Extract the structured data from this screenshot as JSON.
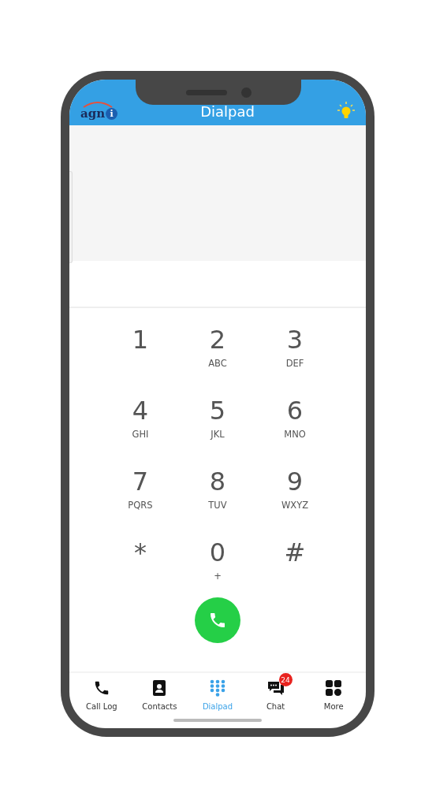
{
  "header": {
    "logo_text": "agn",
    "logo_mark": "i",
    "title": "Dialpad"
  },
  "keypad": [
    {
      "digit": "1"
    },
    {
      "digit": "2",
      "letters": "ABC"
    },
    {
      "digit": "3",
      "letters": "DEF"
    },
    {
      "digit": "4",
      "letters": "GHI"
    },
    {
      "digit": "5",
      "letters": "JKL"
    },
    {
      "digit": "6",
      "letters": "MNO"
    },
    {
      "digit": "7",
      "letters": "PQRS"
    },
    {
      "digit": "8",
      "letters": "TUV"
    },
    {
      "digit": "9",
      "letters": "WXYZ"
    },
    {
      "digit": "*"
    },
    {
      "digit": "0",
      "letters": "+"
    },
    {
      "digit": "#"
    }
  ],
  "tabs": [
    {
      "kind": "phone",
      "label": "Call Log",
      "selected": false
    },
    {
      "kind": "contacts",
      "label": "Contacts",
      "selected": false
    },
    {
      "kind": "dialpad",
      "label": "Dialpad",
      "selected": true
    },
    {
      "kind": "chat",
      "label": "Chat",
      "selected": false,
      "badge": "24"
    },
    {
      "kind": "grid",
      "label": "More",
      "selected": false
    }
  ]
}
